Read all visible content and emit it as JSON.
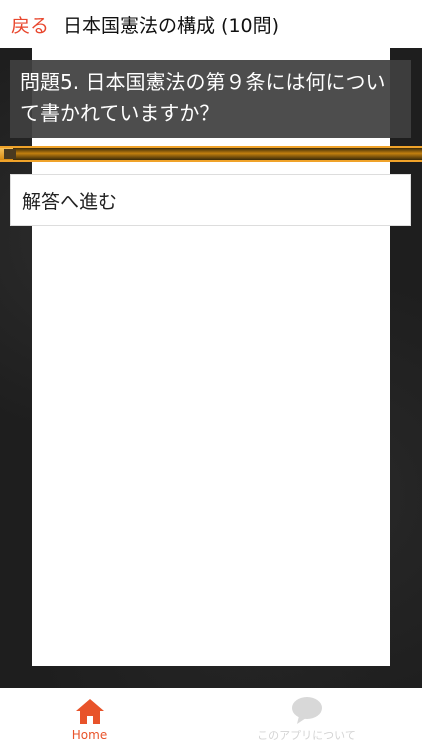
{
  "header": {
    "back_label": "戻る",
    "title": "日本国憲法の構成 (10問)"
  },
  "question": {
    "text": "問題5. 日本国憲法の第９条には何について書かれていますか？"
  },
  "progress": {
    "fraction": 0.03
  },
  "answer_button": {
    "label": "解答へ進む"
  },
  "bottom_nav": {
    "items": [
      {
        "label": "Home",
        "icon": "home-icon",
        "active": true
      },
      {
        "label": "このアプリについて",
        "icon": "chat-bubble-icon",
        "active": false
      }
    ]
  },
  "colors": {
    "accent": "#e8472e",
    "progress": "#e89a1a",
    "inactive": "#d4d4d4"
  }
}
